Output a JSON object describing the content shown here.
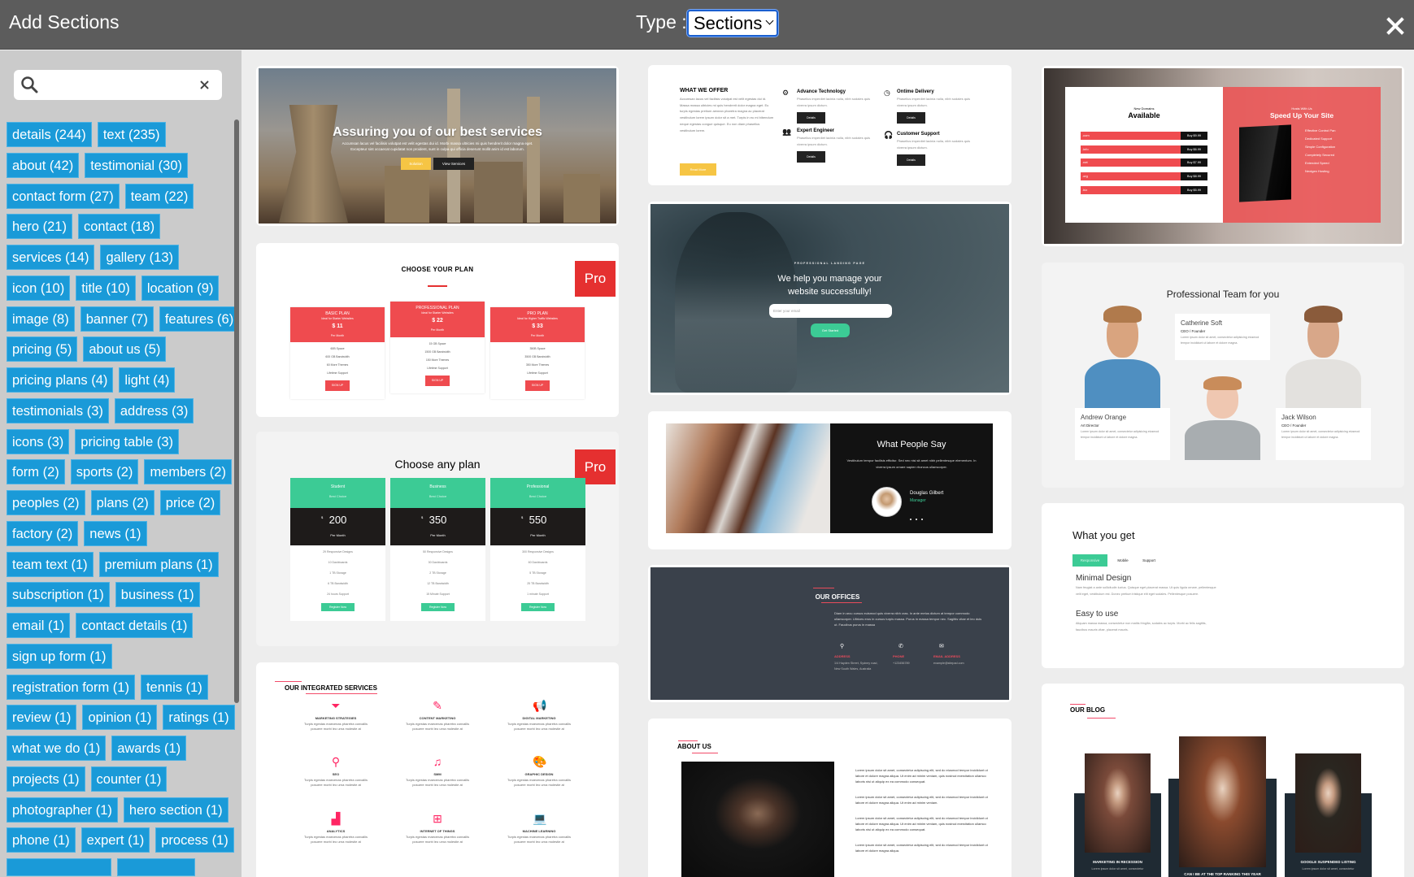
{
  "header": {
    "title": "Add Sections",
    "type_label": "Type :",
    "type_value": "Sections",
    "close_icon": "close-icon"
  },
  "sidebar": {
    "search": {
      "value": "",
      "icon": "search-icon",
      "clear_icon": "close-icon"
    },
    "tag_rows": [
      [
        "details (244)",
        "text (235)"
      ],
      [
        "about (42)",
        "testimonial (30)"
      ],
      [
        "contact form (27)",
        "team (22)"
      ],
      [
        "hero (21)",
        "contact (18)"
      ],
      [
        "services (14)",
        "gallery (13)"
      ],
      [
        "icon (10)",
        "title (10)",
        "location (9)"
      ],
      [
        "image (8)",
        "banner (7)",
        "features (6)"
      ],
      [
        "pricing (5)",
        "about us (5)"
      ],
      [
        "pricing plans (4)",
        "light (4)"
      ],
      [
        "testimonials (3)",
        "address (3)"
      ],
      [
        "icons (3)",
        "pricing table (3)"
      ],
      [
        "form (2)",
        "sports (2)",
        "members (2)"
      ],
      [
        "peoples (2)",
        "plans (2)",
        "price (2)"
      ],
      [
        "factory (2)",
        "news (1)"
      ],
      [
        "team text (1)",
        "premium plans (1)"
      ],
      [
        "subscription (1)",
        "business (1)"
      ],
      [
        "email (1)",
        "contact details (1)"
      ],
      [
        "sign up form (1)"
      ],
      [
        "registration form (1)",
        "tennis (1)"
      ],
      [
        "review (1)",
        "opinion (1)",
        "ratings (1)"
      ],
      [
        "what we do (1)",
        "awards (1)"
      ],
      [
        "projects (1)",
        "counter (1)"
      ],
      [
        "photographer (1)",
        "hero section (1)"
      ],
      [
        "phone (1)",
        "expert (1)",
        "process (1)"
      ]
    ]
  },
  "colors": {
    "tag": "#1a9ad8",
    "pro_badge": "#e53030",
    "plan_red": "#ef4b4f",
    "plan_green": "#3ccb95",
    "accent_pink": "#f24b6a",
    "header": "#5c5c5c"
  },
  "sections": {
    "hero_services": {
      "title": "Assuring you of our best services",
      "text": "Accumsan lacus vel facilisis volutpat est velit egestas dui id. Morbi massa ultricies mi quis hendrerit dolor magna eget. Excepteur sint occaecat cupidatat non proident, sunt in culpa qui officia deserunt mollit anim id est laborum.",
      "buttons": [
        "Solution",
        "View Services"
      ]
    },
    "choose_your_plan": {
      "title": "CHOOSE YOUR PLAN",
      "badge": "Pro",
      "plans": [
        {
          "name": "BASIC PLAN",
          "sub": "Ideal for Starter Websites",
          "price": "$ 11",
          "period": "Per Month",
          "features": [
            "60B Space",
            "600 GB Bandwidth",
            "60 More Themes",
            "Lifetime Support"
          ],
          "button": "SIGN UP"
        },
        {
          "name": "PROFESSIONAL PLAN",
          "sub": "Ideal for Starter Websites",
          "price": "$ 22",
          "period": "Per Month",
          "features": [
            "15 GB Space",
            "1500 GB Bandwidth",
            "150 More Themes",
            "Lifetime Support"
          ],
          "button": "SIGN UP"
        },
        {
          "name": "PRO PLAN",
          "sub": "Ideal for Higher Traffic Websites",
          "price": "$ 33",
          "period": "Per Month",
          "features": [
            "350B Space",
            "3500 GB Bandwidth",
            "350 More Themes",
            "Lifetime Support"
          ],
          "button": "SIGN UP"
        }
      ]
    },
    "choose_any_plan": {
      "title": "Choose any plan",
      "badge": "Pro",
      "plans": [
        {
          "name": "Student",
          "sub": "Best Choice",
          "currency": "$",
          "price": "200",
          "period": "Per Month",
          "features": [
            "29 Responsive Designs",
            "10 Dashboards",
            "1 TB Storage",
            "6 TB Bandwidth",
            "24 hours Support"
          ],
          "button": "Register Now"
        },
        {
          "name": "Business",
          "sub": "Best Choice",
          "currency": "$",
          "price": "350",
          "period": "Per Month",
          "features": [
            "50 Responsive Designs",
            "30 Dashboards",
            "2 TB Storage",
            "12 TB Bandwidth",
            "15 Minute Support"
          ],
          "button": "Register Now"
        },
        {
          "name": "Professional",
          "sub": "Best Choice",
          "currency": "$",
          "price": "550",
          "period": "Per Month",
          "features": [
            "300 Responsive Designs",
            "60 Dashboards",
            "5 TB Storage",
            "25 TB Bandwidth",
            "1 minute Support"
          ],
          "button": "Register Now"
        }
      ]
    },
    "integrated_services": {
      "title": "OUR INTEGRATED SERVICES",
      "text": "Turpis egestas maecenas pharetra convallis posuere morbi leo urna molestie at",
      "items": [
        {
          "label": "MARKETING STRATEGIES",
          "icon": "funnel-dollar-icon"
        },
        {
          "label": "CONTENT MARKETING",
          "icon": "edit-icon"
        },
        {
          "label": "DIGITAL MARKETING",
          "icon": "megaphone-icon"
        },
        {
          "label": "SEO",
          "icon": "search-dollar-icon"
        },
        {
          "label": "SMM",
          "icon": "social-icon"
        },
        {
          "label": "GRAPHIC DESIGN",
          "icon": "palette-icon"
        },
        {
          "label": "ANALYTICS",
          "icon": "area-chart-icon"
        },
        {
          "label": "INTERNET OF THINGS",
          "icon": "network-icon"
        },
        {
          "label": "MACHINE LEARNING",
          "icon": "laptop-code-icon"
        }
      ]
    },
    "what_we_offer": {
      "title": "WHAT WE OFFER",
      "text": "Accumsan lacus vel facilisis volutpat est velit egestas dui id. Massa massa ultricies mi quis hendrerit dolor magna eget. Eu turpis egestas pretium aenean pharetra magna ac placerat vestibulum lorem ipsum dolor sit a met. Turpis in eu mi bibendum neque egestas congue quisque. Eu non diam phasellus vestibulum lorem.",
      "button": "Read More",
      "item_text": "Phasellus imperdiet lacinia nulla, nibh sodales quis viverra ipsum dictum.",
      "items": [
        {
          "title": "Advance Technology",
          "button": "Details",
          "icon": "gears-icon"
        },
        {
          "title": "Expert Engineer",
          "button": "Details",
          "icon": "users-icon"
        },
        {
          "title": "Ontime Delivery",
          "button": "Details",
          "icon": "clock-icon"
        },
        {
          "title": "Customer Support",
          "button": "Details",
          "icon": "headset-icon"
        }
      ]
    },
    "landing": {
      "kicker": "PROFESSIONAL LANDING PAGE",
      "title": "We help you manage your website successfully!",
      "email_placeholder": "Enter your email",
      "button": "Get Started"
    },
    "testimonial": {
      "title": "What People Say",
      "quote": "Vestibulum tempor facilisis efficitur. Sed nec nisi sit amet nibh pellentesque elementum. In viverra ipsum ornare sapien rhoncus ullamcorper.",
      "name": "Douglas Gilbert",
      "role": "Manager"
    },
    "offices": {
      "title": "OUR OFFICES",
      "text": "Diam in arcu cursus euismod quis viverra nibh cras. In ante metus dictum at tempor commodo ullamcorper. Ultrices eros in cursus turpis massa. Purus in massa tempor nec. Sagittis vitae et leo duis ut. Faucibus purus in massa",
      "contacts": [
        {
          "label": "ADDRESS",
          "value": "1/4 Hayden Street, Sydney road, New South Wales, Australia",
          "icon": "map-pin-icon"
        },
        {
          "label": "PHONE",
          "value": "+123456789",
          "icon": "phone-icon"
        },
        {
          "label": "EMAIL ADDRESS",
          "value": "example@sitepad.com",
          "icon": "envelope-open-icon"
        }
      ]
    },
    "about_us": {
      "title": "ABOUT US",
      "paragraphs": [
        "Lorem ipsum dolor sit amet, consectetur adipiscing elit, sed do eiusmod tempor incididunt ut labore et dolore magna aliqua. Ut enim ad minim veniam, quis nostrud exercitation ullamco laboris nisi ut aliquip ex ea commodo consequat.",
        "Lorem ipsum dolor sit amet, consectetur adipiscing elit, sed do eiusmod tempor incididunt ut labore et dolore magna aliqua. Ut enim ad minim veniam.",
        "Lorem ipsum dolor sit amet, consectetur adipiscing elit, sed do eiusmod tempor incididunt ut labore et dolore magna aliqua. Ut enim ad minim veniam, quis nostrud exercitation ullamco laboris nisi ut aliquip ex ea commodo consequat.",
        "Lorem ipsum dolor sit amet, consectetur adipiscing elit, sed do eiusmod tempor incididunt ut labore et dolore magna aliqua."
      ]
    },
    "domains": {
      "kicker": "New Domains",
      "title": "Available",
      "rows": [
        {
          "tld": ".com",
          "price": "Buy $9.99"
        },
        {
          "tld": ".info",
          "price": "Buy $6.99"
        },
        {
          "tld": ".net",
          "price": "Buy $7.99"
        },
        {
          "tld": ".org",
          "price": "Buy $8.99"
        },
        {
          "tld": ".biz",
          "price": "Buy $5.99"
        }
      ],
      "host_kicker": "Hosts With Us",
      "host_title": "Speed Up Your Site",
      "features": [
        "Effective Control Pan",
        "Dedicated Support",
        "Simple Configuration",
        "Completely Secured",
        "Extended Speed",
        "Nextgen Hosting"
      ]
    },
    "team": {
      "title": "Professional Team for you",
      "member_text": "Lorem ipsum dolor sit amet, consectetur adipisicing eiusmod tempor incididunt ut labore et dolore magna.",
      "members": [
        {
          "name": "Andrew Orange",
          "role": "Art Director"
        },
        {
          "name": "Catherine Soft",
          "role": "CEO / Founder"
        },
        {
          "name": "Jack Wilson",
          "role": "CEO / Founder"
        }
      ]
    },
    "what_you_get": {
      "title": "What you get",
      "tabs": [
        "Responsive",
        "Mobile",
        "Support"
      ],
      "active_tab": "Responsive",
      "features": [
        {
          "title": "Minimal Design",
          "text": "Nam feugiat a ante sollicitudin luctus. Quisque eget placerat massa. Ut quis ligula ornare, pellentesque velit eget, vestibulum est. Donec pretium tristique elit eget sodales. Pellentesque posuere."
        },
        {
          "title": "Easy to use",
          "text": "Aliquam massa massa, consectetur non mattis fringilla, sodales ac turpis. Morbi ac felis sagittis, faucibus mauris vitae, placerat mauris."
        }
      ]
    },
    "blog": {
      "title": "OUR BLOG",
      "post_text": "Lorem ipsum dolor sit amet, consectetur",
      "posts": [
        {
          "title": "MARKETING IN RECESSION"
        },
        {
          "title": "CAN I BE AT THE TOP RANKING THIS YEAR"
        },
        {
          "title": "GOOGLE SUSPENDED LISTING"
        }
      ]
    }
  }
}
